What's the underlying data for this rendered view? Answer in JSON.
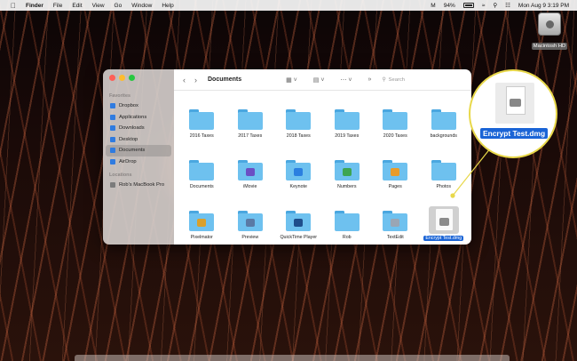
{
  "menubar": {
    "apple_icon": "apple-icon",
    "app_name": "Finder",
    "menus": [
      "File",
      "Edit",
      "View",
      "Go",
      "Window",
      "Help"
    ],
    "battery_percent": "94%",
    "clock": "Mon Aug 9  3:19 PM"
  },
  "desktop": {
    "drive_label": "Macintosh HD"
  },
  "window": {
    "title": "Documents",
    "search_placeholder": "Search",
    "sidebar": {
      "favorites_header": "Favorites",
      "favorites": [
        {
          "label": "Dropbox",
          "icon": "dropbox-icon"
        },
        {
          "label": "Applications",
          "icon": "applications-icon"
        },
        {
          "label": "Downloads",
          "icon": "downloads-icon"
        },
        {
          "label": "Desktop",
          "icon": "desktop-icon"
        },
        {
          "label": "Documents",
          "icon": "documents-icon",
          "active": true
        },
        {
          "label": "AirDrop",
          "icon": "airdrop-icon"
        }
      ],
      "locations_header": "Locations",
      "locations": [
        {
          "label": "Rob's MacBook Pro",
          "icon": "laptop-icon"
        }
      ]
    },
    "files": [
      {
        "name": "2016 Taxes",
        "kind": "folder"
      },
      {
        "name": "2017 Taxes",
        "kind": "folder"
      },
      {
        "name": "2018 Taxes",
        "kind": "folder"
      },
      {
        "name": "2019 Taxes",
        "kind": "folder"
      },
      {
        "name": "2020 Taxes",
        "kind": "folder"
      },
      {
        "name": "backgrounds",
        "kind": "folder"
      },
      {
        "name": "Documents",
        "kind": "folder"
      },
      {
        "name": "iMovie",
        "kind": "folder",
        "emblem": "#6b4fc4"
      },
      {
        "name": "Keynote",
        "kind": "folder",
        "emblem": "#2b7fe0"
      },
      {
        "name": "Numbers",
        "kind": "folder",
        "emblem": "#3da552"
      },
      {
        "name": "Pages",
        "kind": "folder",
        "emblem": "#e89b2a"
      },
      {
        "name": "Photos",
        "kind": "folder"
      },
      {
        "name": "Pixelmator",
        "kind": "folder",
        "emblem": "#d9a02c"
      },
      {
        "name": "Preview",
        "kind": "folder",
        "emblem": "#5a7aa5"
      },
      {
        "name": "QuickTime Player",
        "kind": "folder",
        "emblem": "#1f4e8c"
      },
      {
        "name": "Rob",
        "kind": "folder"
      },
      {
        "name": "TextEdit",
        "kind": "folder",
        "emblem": "#9aa6b5"
      },
      {
        "name": "Encrypt Test.dmg",
        "kind": "dmg",
        "selected": true
      }
    ]
  },
  "callout": {
    "label": "Encrypt Test.dmg"
  },
  "colors": {
    "selection": "#1a64d6",
    "folder": "#6ec1ef",
    "callout_border": "#e8d84a"
  }
}
